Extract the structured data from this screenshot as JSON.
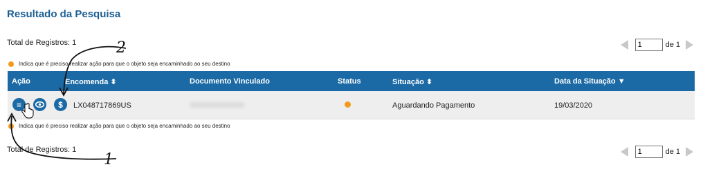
{
  "page": {
    "title": "Resultado da Pesquisa"
  },
  "summary": {
    "total_label": "Total de Registros: 1",
    "legend_text": "Indica que é preciso realizar ação para que o objeto seja encaminhado ao seu destino"
  },
  "pager": {
    "current_page": "1",
    "of_label": "de 1"
  },
  "table": {
    "headers": {
      "acao": "Ação",
      "encomenda": "Encomenda ⬍",
      "documento": "Documento Vinculado",
      "status": "Status",
      "situacao": "Situação ⬍",
      "data": "Data da Situação ▼"
    },
    "rows": [
      {
        "encomenda": "LX048717869US",
        "documento": "",
        "status": "pending-action",
        "situacao": "Aguardando Pagamento",
        "data": "19/03/2020"
      }
    ]
  },
  "annotations": {
    "label_2": "2",
    "label_1": "1"
  },
  "colors": {
    "accent": "#1b6aa5",
    "title": "#1a5e94",
    "status_dot": "#f39a1d",
    "row_bg": "#eeeeee"
  },
  "icons": [
    "details-icon",
    "view-icon",
    "dollar-icon",
    "cursor-hand-icon",
    "page-prev-icon",
    "page-next-icon"
  ]
}
